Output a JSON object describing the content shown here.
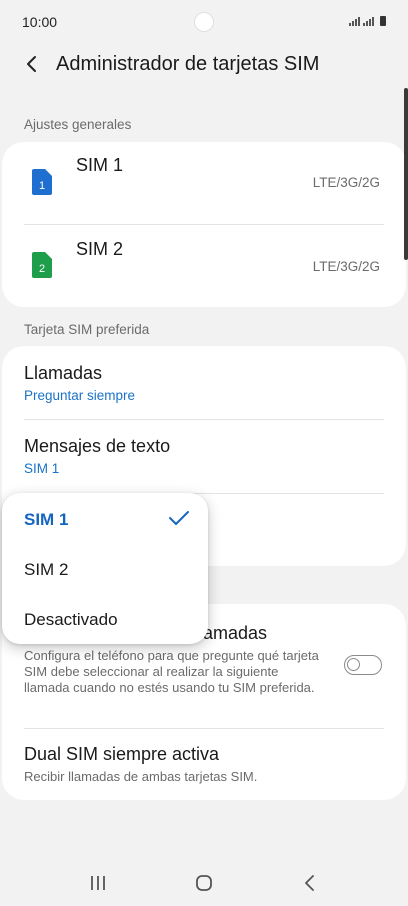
{
  "status_bar": {
    "time": "10:00"
  },
  "header": {
    "title": "Administrador de tarjetas SIM"
  },
  "general": {
    "label": "Ajustes generales",
    "sims": [
      {
        "name": "SIM 1",
        "badge": "1",
        "network": "LTE/3G/2G",
        "color": "#1e6fd0"
      },
      {
        "name": "SIM 2",
        "badge": "2",
        "network": "LTE/3G/2G",
        "color": "#1e9e4a"
      }
    ]
  },
  "preferred": {
    "label": "Tarjeta SIM preferida",
    "calls": {
      "title": "Llamadas",
      "value": "Preguntar siempre"
    },
    "messages": {
      "title": "Mensajes de texto",
      "value": "SIM 1"
    }
  },
  "confirm": {
    "title_visible": "llamadas",
    "description": "Configura el teléfono para que pregunte qué tarjeta SIM debe seleccionar al realizar la siguiente llamada cuando no estés usando tu SIM preferida.",
    "toggle_on": false
  },
  "dual": {
    "title": "Dual SIM siempre activa",
    "description": "Recibir llamadas de ambas tarjetas SIM."
  },
  "popup": {
    "options": [
      "SIM 1",
      "SIM 2",
      "Desactivado"
    ],
    "selected": "SIM 1"
  },
  "colors": {
    "accent": "#1565c0",
    "link": "#1a73c7"
  }
}
